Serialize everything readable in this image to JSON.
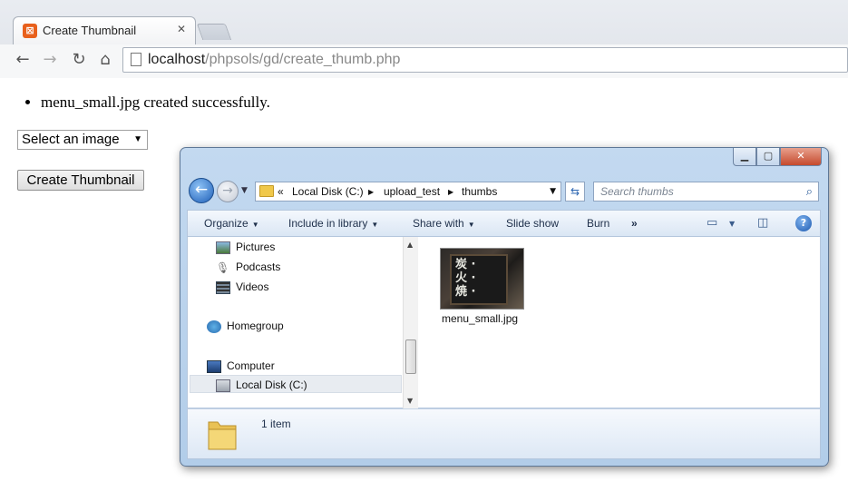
{
  "browser": {
    "tab_title": "Create Thumbnail",
    "url_host": "localhost",
    "url_path": "/phpsols/gd/create_thumb.php"
  },
  "page": {
    "messages": [
      "menu_small.jpg created successfully."
    ],
    "select_value": "Select an image",
    "button_label": "Create Thumbnail"
  },
  "explorer": {
    "breadcrumb": [
      "Local Disk (C:)",
      "upload_test",
      "thumbs"
    ],
    "search_placeholder": "Search thumbs",
    "commands": [
      "Organize",
      "Include in library",
      "Share with",
      "Slide show",
      "Burn"
    ],
    "more_glyph": "»",
    "nav_items": [
      "Pictures",
      "Podcasts",
      "Videos",
      "Homegroup",
      "Computer",
      "Local Disk (C:)"
    ],
    "files": [
      {
        "name": "menu_small.jpg"
      }
    ],
    "status": "1 item"
  }
}
